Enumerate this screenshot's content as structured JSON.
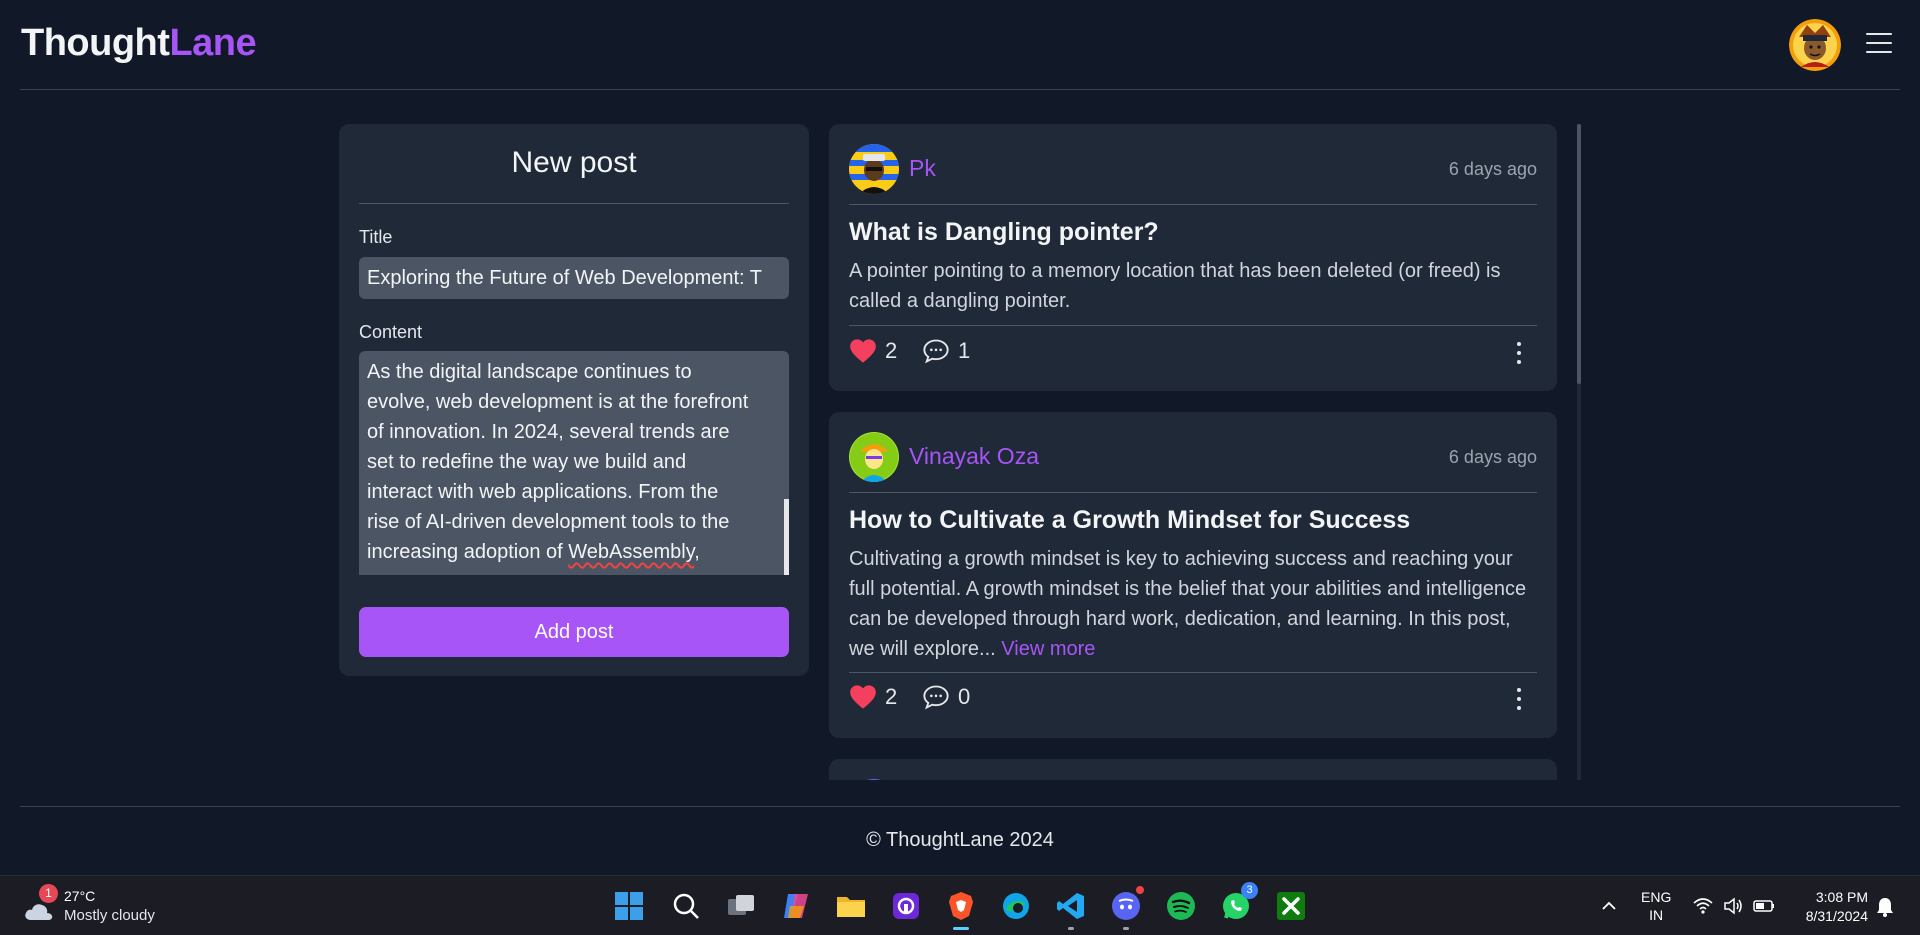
{
  "app": {
    "logo_part1": "Thought",
    "logo_part2": "Lane"
  },
  "new_post": {
    "heading": "New post",
    "title_label": "Title",
    "title_value": "Exploring the Future of Web Development: T",
    "content_label": "Content",
    "content_lines": [
      "As the digital landscape continues to",
      "evolve, web development is at the forefront",
      "of innovation. In 2024, several trends are",
      "set to redefine the way we build and",
      "interact with web applications. From the",
      "rise of AI-driven development tools to the",
      "increasing adoption of ",
      "WebAssembly",
      ","
    ],
    "submit_label": "Add post"
  },
  "posts": [
    {
      "author": "Pk",
      "time": "6 days ago",
      "title": "What is Dangling pointer?",
      "body": "A pointer pointing to a memory location that has been deleted (or freed) is called a dangling pointer.",
      "likes": "2",
      "comments": "1"
    },
    {
      "author": "Vinayak Oza",
      "time": "6 days ago",
      "title": "How to Cultivate a Growth Mindset for Success",
      "body": "Cultivating a growth mindset is key to achieving success and reaching your full potential. A growth mindset is the belief that your abilities and intelligence can be developed through hard work, dedication, and learning. In this post, we will explore...",
      "view_more": "View more",
      "likes": "2",
      "comments": "0"
    }
  ],
  "footer": {
    "copyright": "© ThoughtLane 2024"
  },
  "taskbar": {
    "weather_badge": "1",
    "temperature": "27°C",
    "condition": "Mostly cloudy",
    "whatsapp_badge": "3",
    "lang_line1": "ENG",
    "lang_line2": "IN",
    "time": "3:08 PM",
    "date": "8/31/2024"
  },
  "colors": {
    "background": "#111827",
    "card": "#1f2937",
    "accent": "#a855f7",
    "like": "#f43f5e"
  },
  "icons": {
    "like": "heart-icon",
    "comment": "comment-bubble-icon",
    "menu": "hamburger-icon",
    "more": "more-vertical-icon"
  }
}
